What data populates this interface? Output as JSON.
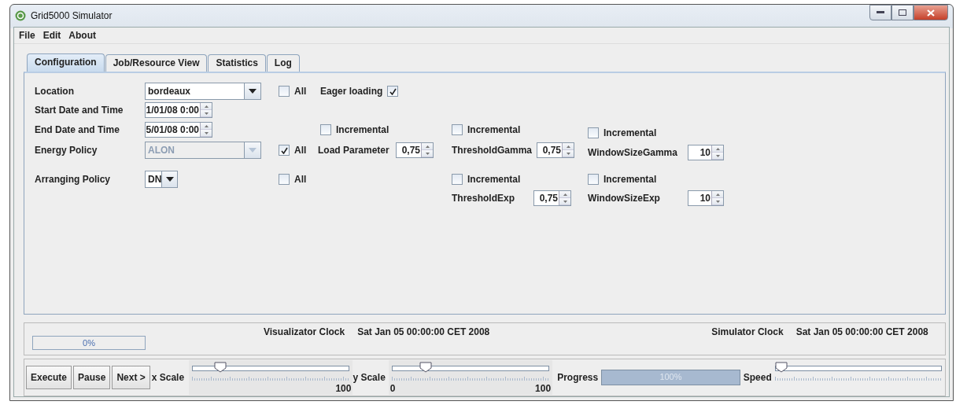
{
  "window": {
    "title": "Grid5000 Simulator"
  },
  "menu": [
    {
      "label": "File"
    },
    {
      "label": "Edit"
    },
    {
      "label": "About"
    }
  ],
  "tabs": [
    {
      "label": "Configuration",
      "selected": true
    },
    {
      "label": "Job/Resource View",
      "selected": false
    },
    {
      "label": "Statistics",
      "selected": false
    },
    {
      "label": "Log",
      "selected": false
    }
  ],
  "config": {
    "fields": [
      {
        "label": "Location",
        "kind": "combo",
        "value": "bordeaux",
        "disabled": false,
        "all": {
          "label": "All",
          "checked": false
        }
      },
      {
        "label": "Start Date and Time",
        "kind": "spinner",
        "value": "1/01/08 0:00"
      },
      {
        "label": "End Date and Time",
        "kind": "spinner",
        "value": "5/01/08 0:00"
      },
      {
        "label": "Energy Policy",
        "kind": "combo",
        "value": "ALON",
        "disabled": true,
        "all": {
          "label": "All",
          "checked": true
        }
      },
      {
        "label": "Arranging Policy",
        "kind": "small_combo",
        "value": "DN",
        "disabled": false,
        "all": {
          "label": "All",
          "checked": false
        }
      }
    ],
    "eager_loading": {
      "label": "Eager loading",
      "checked": true
    },
    "parameters": [
      {
        "incremental": {
          "label": "Incremental",
          "checked": false
        },
        "label": "Load Parameter",
        "value": "0,75"
      },
      {
        "incremental": {
          "label": "Incremental",
          "checked": false
        },
        "label": "ThresholdGamma",
        "value": "0,75"
      },
      {
        "incremental": {
          "label": "Incremental",
          "checked": false
        },
        "label": "WindowSizeGamma",
        "value": "10"
      },
      {
        "incremental": {
          "label": "Incremental",
          "checked": false
        },
        "label": "ThresholdExp",
        "value": "0,75"
      },
      {
        "incremental": {
          "label": "Incremental",
          "checked": false
        },
        "label": "WindowSizeExp",
        "value": "10"
      }
    ]
  },
  "status": {
    "progress": {
      "text": "0%",
      "level": 0
    },
    "clocks": [
      {
        "label": "Visualizator Clock",
        "value": "Sat Jan 05 00:00:00 CET 2008"
      },
      {
        "label": "Simulator Clock",
        "value": "Sat Jan 05 00:00:00 CET 2008"
      }
    ]
  },
  "controls": {
    "buttons": [
      {
        "label": "Execute"
      },
      {
        "label": "Pause"
      },
      {
        "label": "Next >"
      }
    ],
    "x_scale": {
      "label": "x Scale",
      "level": 0.15,
      "max_label": "100"
    },
    "y_scale": {
      "label": "y Scale",
      "level": 0.19,
      "min_label": "0",
      "max_label": "100"
    },
    "progress": {
      "label": "Progress",
      "text": "100%",
      "level": 1
    },
    "speed": {
      "label": "Speed",
      "level": 0
    }
  }
}
